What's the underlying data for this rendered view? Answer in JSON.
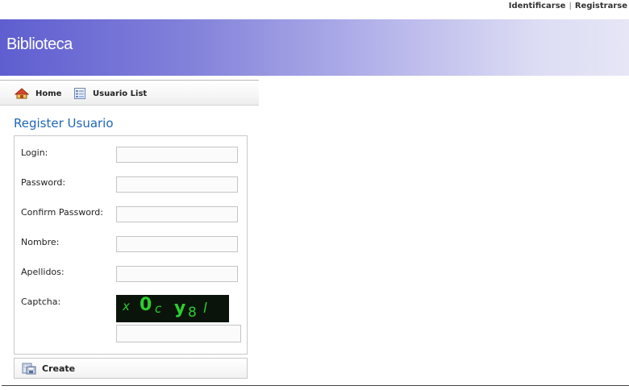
{
  "top_links": {
    "login": "Identificarse",
    "separator": "|",
    "register": "Registrarse"
  },
  "header": {
    "title": "Biblioteca"
  },
  "menu": {
    "items": [
      {
        "label": "Home",
        "icon": "home-icon"
      },
      {
        "label": "Usuario List",
        "icon": "list-icon"
      }
    ]
  },
  "page": {
    "title": "Register Usuario"
  },
  "form": {
    "fields": [
      {
        "label": "Login:",
        "value": ""
      },
      {
        "label": "Password:",
        "value": ""
      },
      {
        "label": "Confirm Password:",
        "value": ""
      },
      {
        "label": "Nombre:",
        "value": ""
      },
      {
        "label": "Apellidos:",
        "value": ""
      },
      {
        "label": "Captcha:",
        "value": ""
      }
    ],
    "captcha_text": [
      "x",
      "0",
      "c",
      "y",
      "8",
      "l"
    ]
  },
  "actions": {
    "create_label": "Create"
  },
  "colors": {
    "header_start": "#5f5ed0",
    "header_end": "#e6e6f6",
    "title_blue": "#1f67b5",
    "captcha_green": "#2ecc2e"
  }
}
